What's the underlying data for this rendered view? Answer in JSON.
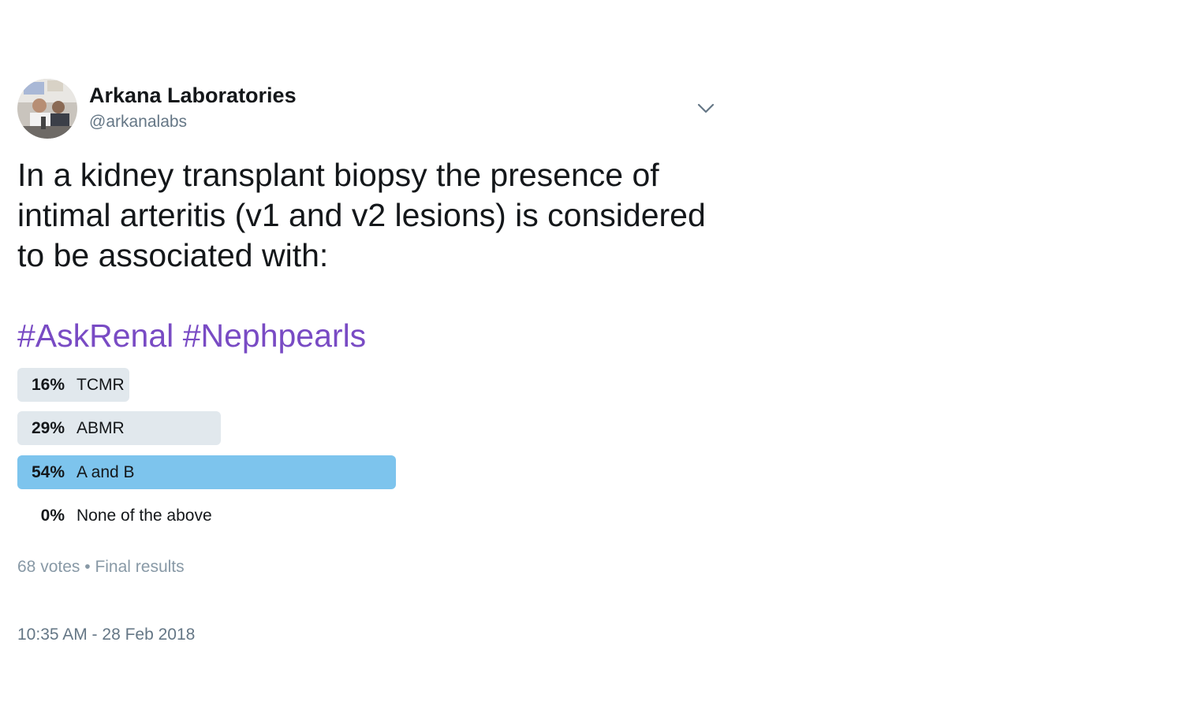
{
  "author": {
    "name": "Arkana Laboratories",
    "handle": "@arkanalabs"
  },
  "tweet": {
    "text": "In a kidney transplant biopsy the presence of intimal arteritis (v1 and v2 lesions) is considered to be associated with:",
    "hashtags": [
      "#AskRenal",
      "#Nephpearls"
    ]
  },
  "poll": {
    "choices": [
      {
        "percent": "16%",
        "label": "TCMR",
        "fraction": 0.16,
        "leader": false
      },
      {
        "percent": "29%",
        "label": "ABMR",
        "fraction": 0.29,
        "leader": false
      },
      {
        "percent": "54%",
        "label": "A and B",
        "fraction": 0.54,
        "leader": true
      },
      {
        "percent": "0%",
        "label": "None of the above",
        "fraction": 0.0,
        "leader": false
      }
    ],
    "votes": "68 votes",
    "separator": "•",
    "status": "Final results"
  },
  "timestamp": "10:35 AM - 28 Feb 2018",
  "colors": {
    "hashtag": "#794bc4",
    "bar": "#e1e8ed",
    "leader_bar": "#7dc4ed",
    "muted": "#657786"
  },
  "icons": {
    "caret": "chevron-down-icon",
    "avatar": "avatar-photo"
  }
}
